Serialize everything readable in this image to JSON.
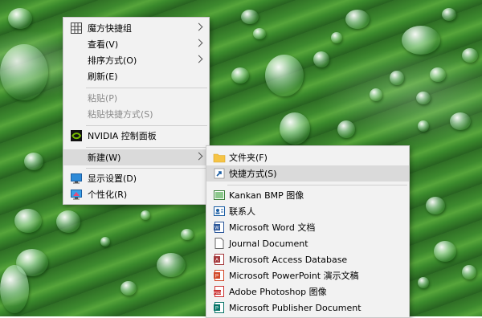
{
  "context_menu": {
    "items": [
      {
        "label": "魔方快捷组"
      },
      {
        "label": "查看(V)"
      },
      {
        "label": "排序方式(O)"
      },
      {
        "label": "刷新(E)"
      },
      {
        "label": "粘贴(P)"
      },
      {
        "label": "粘贴快捷方式(S)"
      },
      {
        "label": "NVIDIA 控制面板"
      },
      {
        "label": "新建(W)"
      },
      {
        "label": "显示设置(D)"
      },
      {
        "label": "个性化(R)"
      }
    ]
  },
  "new_submenu": {
    "items": [
      {
        "label": "文件夹(F)"
      },
      {
        "label": "快捷方式(S)"
      },
      {
        "label": "Kankan BMP 图像"
      },
      {
        "label": "联系人"
      },
      {
        "label": "Microsoft Word 文档"
      },
      {
        "label": "Journal Document"
      },
      {
        "label": "Microsoft Access Database"
      },
      {
        "label": "Microsoft PowerPoint 演示文稿"
      },
      {
        "label": "Adobe Photoshop 图像"
      },
      {
        "label": "Microsoft Publisher Document"
      }
    ]
  },
  "colors": {
    "menu_bg": "#f2f2f2",
    "highlight": "#dadada",
    "disabled_text": "#8a8a8a",
    "nvidia_green": "#76b900",
    "folder_yellow": "#f6c445"
  }
}
